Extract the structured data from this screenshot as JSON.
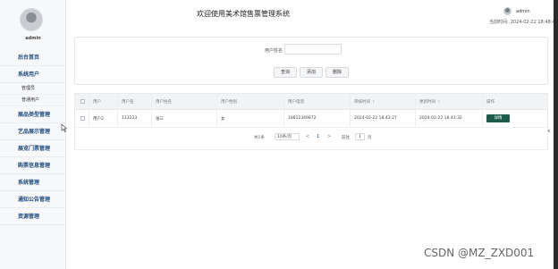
{
  "app": {
    "title": "欢迎使用美术馆售票管理系统",
    "user": "admin",
    "time_label": "当前时间:",
    "time_value": "2024-02-22 18:48:49"
  },
  "sidebar": {
    "admin_name": "admin",
    "items": [
      {
        "label": "后台首页"
      },
      {
        "label": "系统用户"
      },
      {
        "label": "管理员",
        "sub": true
      },
      {
        "label": "普通用户",
        "sub": true
      },
      {
        "label": "展品类型管理"
      },
      {
        "label": "艺品展示管理"
      },
      {
        "label": "展览门票管理"
      },
      {
        "label": "购票信息管理"
      },
      {
        "label": "系统管理"
      },
      {
        "label": "通知公告管理"
      },
      {
        "label": "资源管理"
      }
    ]
  },
  "search": {
    "label": "用户姓名",
    "placeholder": "",
    "buttons": {
      "query": "查询",
      "add": "添加",
      "delete": "删除"
    }
  },
  "table": {
    "headers": [
      "",
      "用户",
      "用户名",
      "用户姓名",
      "用户性别",
      "用户电话",
      "审核时间",
      "更新时间",
      "操作"
    ],
    "rows": [
      {
        "user": "用户2",
        "username": "113223",
        "name": "张三",
        "gender": "女",
        "phone": "18812349872",
        "audit_time": "2024-02-22 18:43:27",
        "update_time": "2024-02-22 18:43:32",
        "action": "详情"
      }
    ]
  },
  "pager": {
    "total": "共1条",
    "page_size": "10条/页",
    "prev": "<",
    "page": "1",
    "next": ">",
    "goto": "前往",
    "goto_value": "1",
    "page_unit": "页"
  },
  "watermark": "CSDN @MZ_ZXD001",
  "colors": {
    "primary_text": "#1f4b7a",
    "detail_button": "#1b5c4a"
  }
}
